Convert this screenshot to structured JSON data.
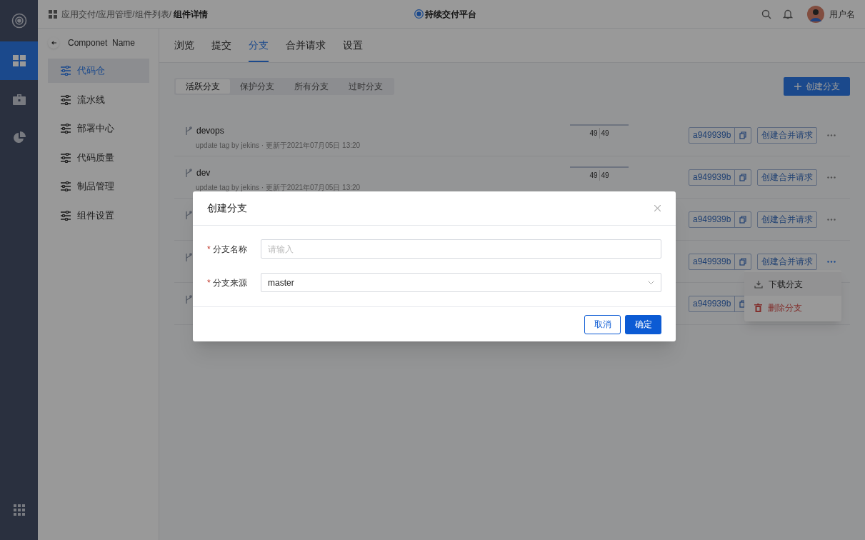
{
  "breadcrumb": {
    "items": [
      "应用交付/",
      "应用管理/",
      "组件列表/"
    ],
    "current": "组件详情"
  },
  "platform": {
    "title": "持续交付平台"
  },
  "user": {
    "name": "用户名"
  },
  "rail": {
    "items": [
      {
        "kind": "grid",
        "selected": true
      },
      {
        "kind": "briefcase",
        "selected": false
      },
      {
        "kind": "pie",
        "selected": false
      }
    ]
  },
  "component": {
    "name": "Componet  Name"
  },
  "sidebar": {
    "items": [
      {
        "label": "代码仓",
        "selected": true
      },
      {
        "label": "流水线",
        "selected": false
      },
      {
        "label": "部署中心",
        "selected": false
      },
      {
        "label": "代码质量",
        "selected": false
      },
      {
        "label": "制品管理",
        "selected": false
      },
      {
        "label": "组件设置",
        "selected": false
      }
    ]
  },
  "tabs": [
    {
      "label": "浏览",
      "selected": false
    },
    {
      "label": "提交",
      "selected": false
    },
    {
      "label": "分支",
      "selected": true
    },
    {
      "label": "合并请求",
      "selected": false
    },
    {
      "label": "设置",
      "selected": false
    }
  ],
  "filters": [
    {
      "label": "活跃分支",
      "selected": true
    },
    {
      "label": "保护分支",
      "selected": false
    },
    {
      "label": "所有分支",
      "selected": false
    },
    {
      "label": "过时分支",
      "selected": false
    }
  ],
  "create_button": {
    "label": "创建分支"
  },
  "branches": [
    {
      "name": "devops",
      "meta": "update tag by jekins · 更新于2021年07月05日 13:20",
      "behind": "49",
      "ahead": "49",
      "hash": "a949939b",
      "merge": "创建合并请求"
    },
    {
      "name": "dev",
      "meta": "update tag by jekins · 更新于2021年07月05日 13:20",
      "behind": "49",
      "ahead": "49",
      "hash": "a949939b",
      "merge": "创建合并请求"
    },
    {
      "hash": "a949939b",
      "merge": "创建合并请求"
    },
    {
      "hash": "a949939b",
      "merge": "创建合并请求",
      "menu_open": true
    },
    {
      "hash": "a949939b"
    }
  ],
  "branch_menu": [
    {
      "label": "下载分支",
      "kind": "normal"
    },
    {
      "label": "删除分支",
      "kind": "danger"
    }
  ],
  "dialog": {
    "title": "创建分支",
    "required_mark": "*",
    "fields": [
      {
        "label": "分支名称",
        "kind": "input",
        "required": true,
        "placeholder": "请输入"
      },
      {
        "label": "分支来源",
        "kind": "select",
        "required": true,
        "value": "master"
      }
    ],
    "buttons": [
      {
        "label": "取消",
        "kind": "secondary"
      },
      {
        "label": "确定",
        "kind": "primary"
      }
    ]
  }
}
